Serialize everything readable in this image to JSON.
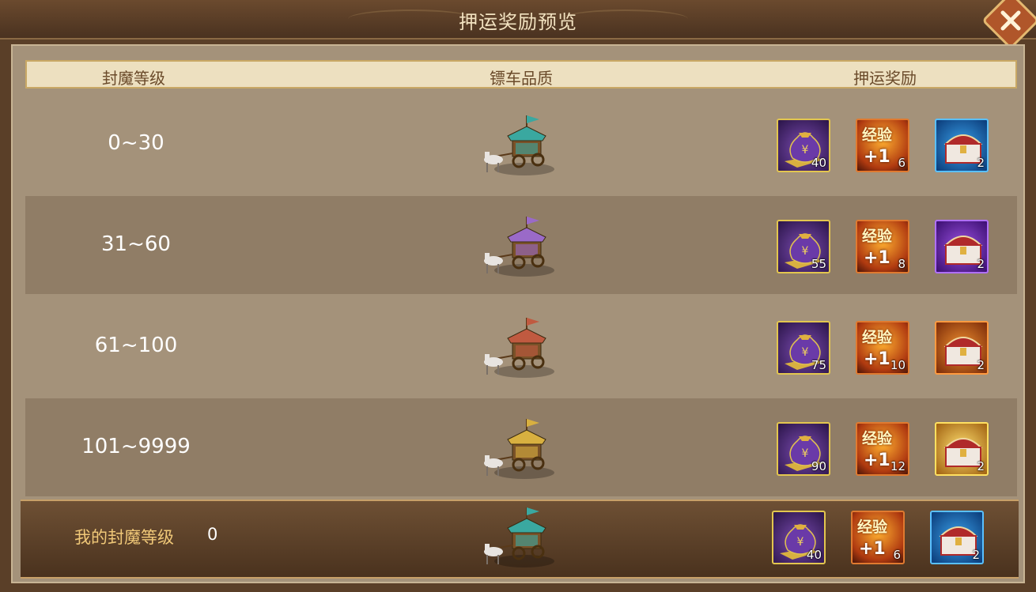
{
  "window": {
    "title": "押运奖励预览"
  },
  "table": {
    "columns": [
      "封魔等级",
      "镖车品质",
      "押运奖励"
    ],
    "rows": [
      {
        "level": "0~30",
        "cart": "teal-cart",
        "rewards": [
          {
            "icon": "money-bag-icon",
            "qty": "40"
          },
          {
            "icon": "exp-icon",
            "label": "经验",
            "plus": "+1",
            "qty": "6"
          },
          {
            "icon": "blue-chest-icon",
            "qty": "2"
          }
        ]
      },
      {
        "level": "31~60",
        "cart": "purple-cart",
        "rewards": [
          {
            "icon": "money-bag-icon",
            "qty": "55"
          },
          {
            "icon": "exp-icon",
            "label": "经验",
            "plus": "+1",
            "qty": "8"
          },
          {
            "icon": "purple-chest-icon",
            "qty": "2"
          }
        ]
      },
      {
        "level": "61~100",
        "cart": "red-cart",
        "rewards": [
          {
            "icon": "money-bag-icon",
            "qty": "75"
          },
          {
            "icon": "exp-icon",
            "label": "经验",
            "plus": "+1",
            "qty": "10"
          },
          {
            "icon": "orange-chest-icon",
            "qty": "2"
          }
        ]
      },
      {
        "level": "101~9999",
        "cart": "gold-cart",
        "rewards": [
          {
            "icon": "money-bag-icon",
            "qty": "90"
          },
          {
            "icon": "exp-icon",
            "label": "经验",
            "plus": "+1",
            "qty": "12"
          },
          {
            "icon": "gold-chest-icon",
            "qty": "2"
          }
        ]
      }
    ]
  },
  "my_status": {
    "label": "我的封魔等级",
    "value": "0",
    "cart": "teal-cart",
    "rewards": [
      {
        "icon": "money-bag-icon",
        "qty": "40"
      },
      {
        "icon": "exp-icon",
        "label": "经验",
        "plus": "+1",
        "qty": "6"
      },
      {
        "icon": "blue-chest-icon",
        "qty": "2"
      }
    ]
  },
  "colors": {
    "teal-cart": "#3aa8a0",
    "purple-cart": "#9a6ac8",
    "red-cart": "#c05a40",
    "gold-cart": "#d8b040"
  }
}
